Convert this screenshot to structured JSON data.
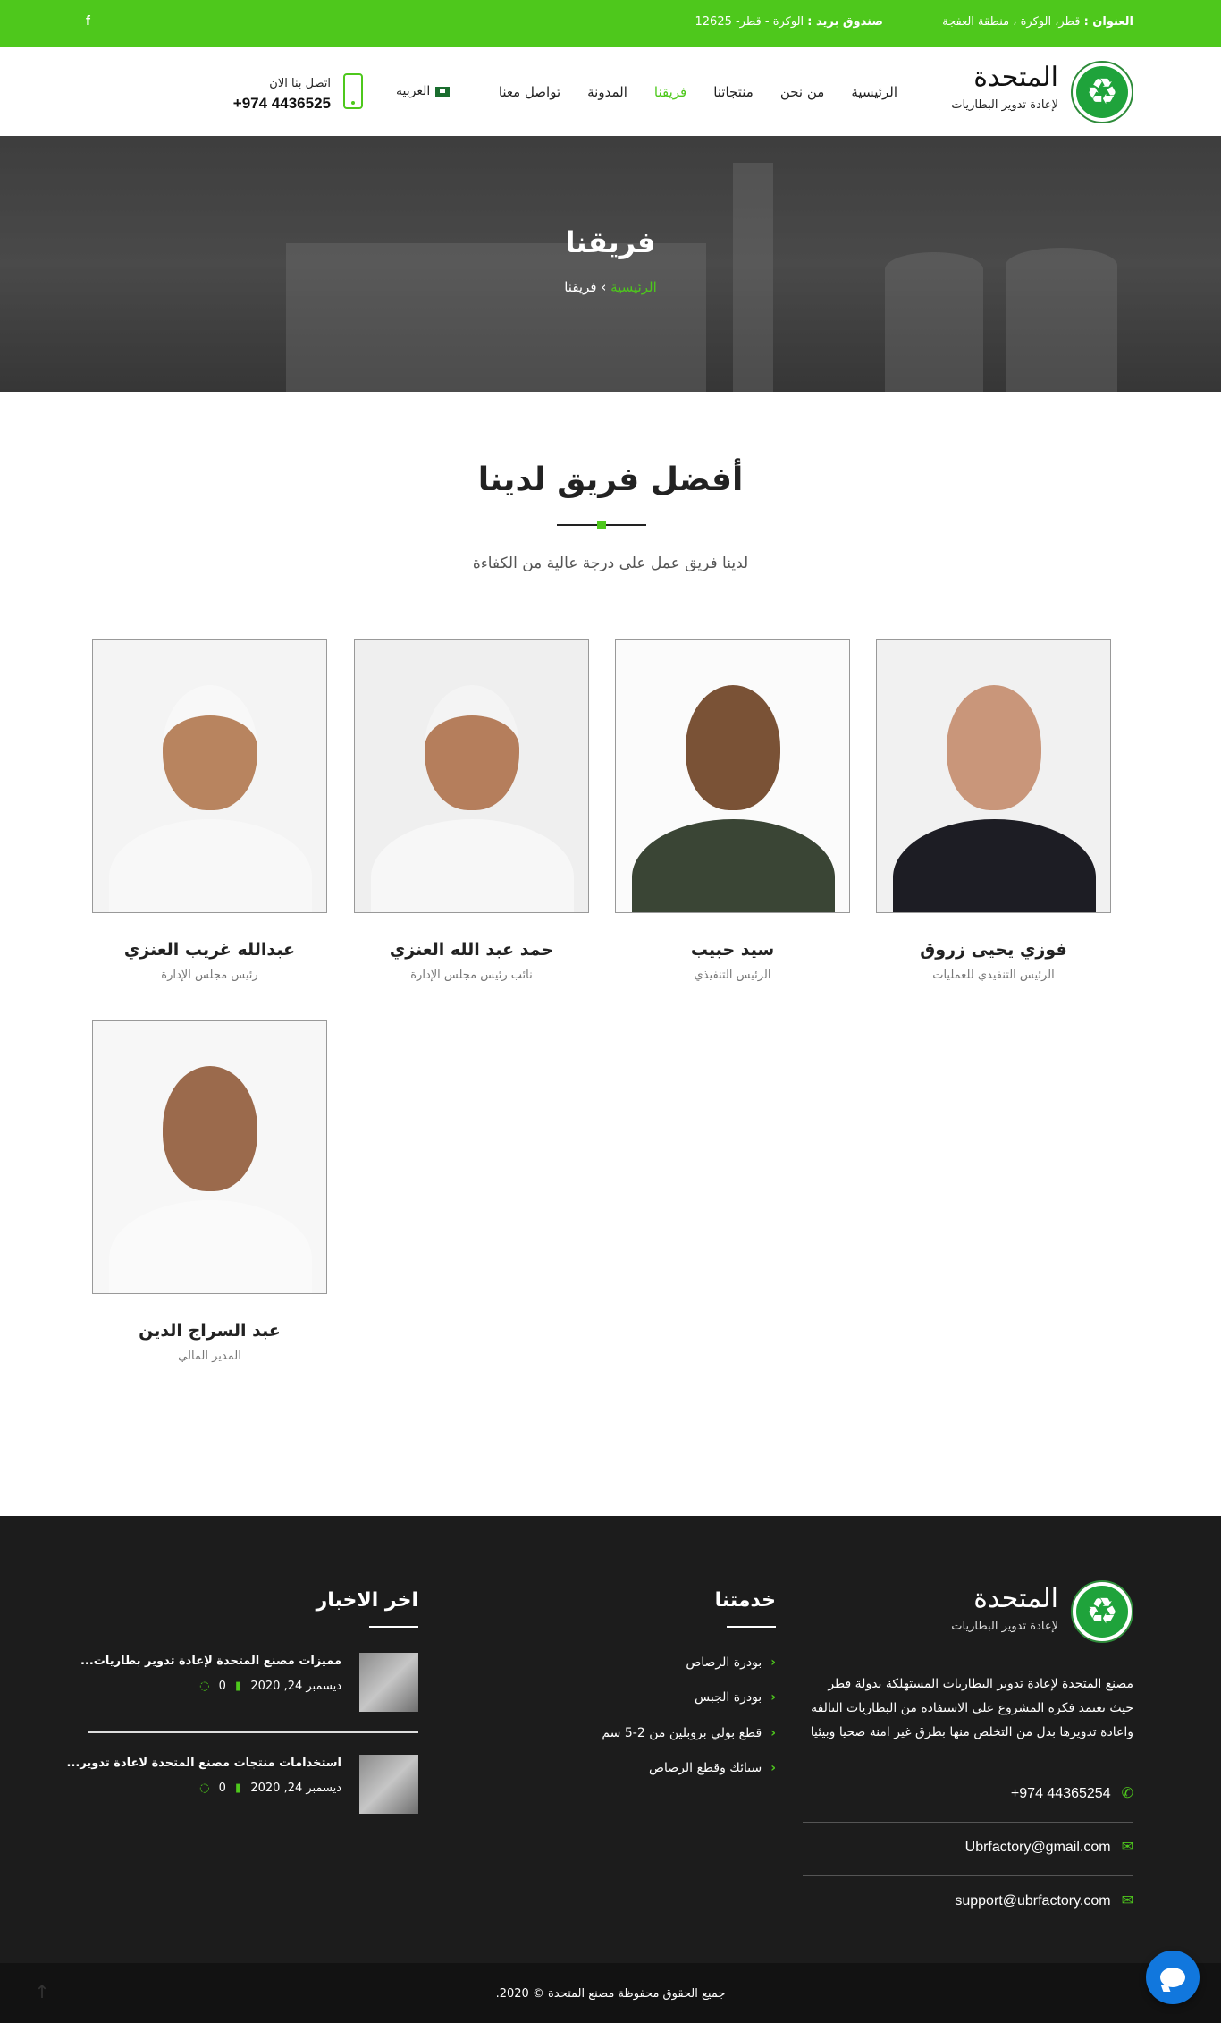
{
  "topbar": {
    "address_label": "العنوان :",
    "address_value": "قطر، الوكرة ، منطقة العفجة",
    "pobox_label": "صندوق بريد :",
    "pobox_value": "الوكرة - قطر- 12625",
    "facebook_glyph": "f"
  },
  "header": {
    "logo_name": "المتحدة",
    "logo_sub": "لإعادة تدوير البطاريات",
    "nav": [
      {
        "label": "الرئيسية"
      },
      {
        "label": "من نحن"
      },
      {
        "label": "منتجاتنا"
      },
      {
        "label": "فريقنا"
      },
      {
        "label": "المدونة"
      },
      {
        "label": "تواصل معنا"
      }
    ],
    "lang_label": "العربية",
    "call_label": "اتصل بنا الان",
    "call_number": "+974 4436525"
  },
  "hero": {
    "title": "فريقنا",
    "breadcrumb_home": "الرئيسية",
    "breadcrumb_sep": "›",
    "breadcrumb_current": "فريقنا"
  },
  "team": {
    "title": "أفضل فريق لدينا",
    "subtitle": "لدينا فريق عمل على درجة عالية من الكفاءة",
    "members": [
      {
        "name": "فوزي يحيى زروق",
        "role": "الرئيس التنفيذي للعمليات"
      },
      {
        "name": "سيد حبيب",
        "role": "الرئيس التنفيذي"
      },
      {
        "name": "حمد عبد الله العنزي",
        "role": "نائب رئيس مجلس الإدارة"
      },
      {
        "name": "عبدالله غريب العنزي",
        "role": "رئيس مجلس الإدارة"
      },
      {
        "name": "عبد السراج الدين",
        "role": "المدير المالي"
      }
    ]
  },
  "footer": {
    "logo_name": "المتحدة",
    "logo_sub": "لإعادة تدوير البطاريات",
    "about": "مصنع المتحدة لإعادة تدوير البطاريات المستهلكة بدولة قطر حيث تعتمد فكرة المشروع على الاستفادة من البطاريات التالفة واعادة تدويرها بدل من التخلص منها بطرق غير امنة صحيا وبيئيا",
    "phone": "+974 44365254",
    "email1": "Ubrfactory@gmail.com",
    "email2": "support@ubrfactory.com",
    "services_title": "خدمتنا",
    "services": [
      {
        "label": "بودرة الرصاص"
      },
      {
        "label": "بودرة الجبس"
      },
      {
        "label": "قطع بولي بروبلين من 2-5 سم"
      },
      {
        "label": "سبائك وقطع الرصاص"
      }
    ],
    "news_title": "اخر الاخبار",
    "news": [
      {
        "title": "مميزات مصنع المتحدة لإعادة تدوير بطاريات...",
        "comments": "0",
        "date": "ديسمبر 24, 2020"
      },
      {
        "title": "استخدامات منتجات مصنع المتحدة لاعادة تدوير...",
        "comments": "0",
        "date": "ديسمبر 24, 2020"
      }
    ],
    "copyright": "جميع الحقوق محفوظة مصنع المتحدة © 2020."
  },
  "colors": {
    "accent": "#4ec81c",
    "footer_bg": "#1c1c1c",
    "chat": "#1177dd"
  }
}
